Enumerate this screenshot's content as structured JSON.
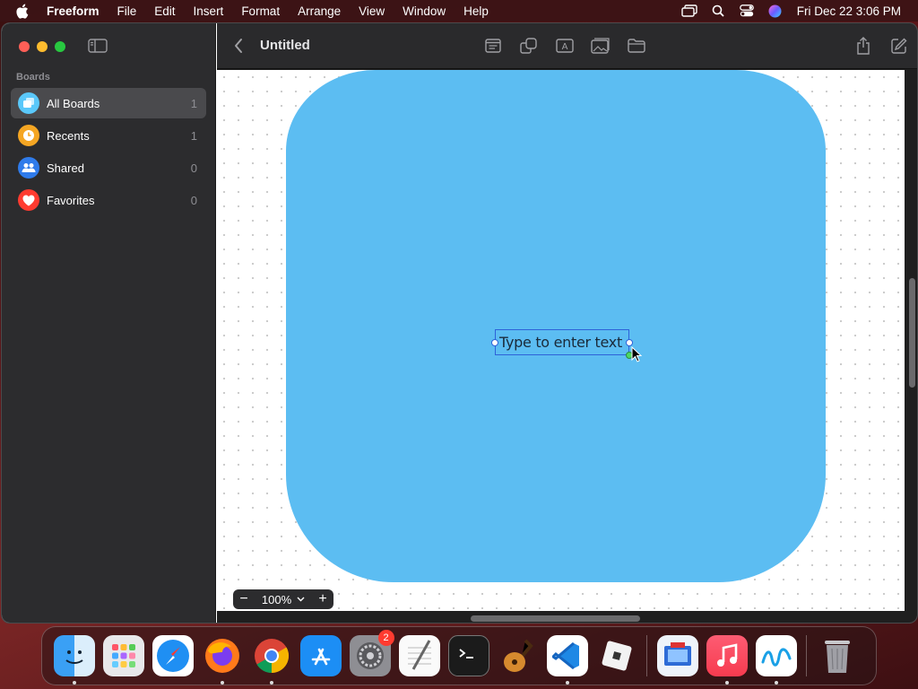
{
  "menubar": {
    "app_name": "Freeform",
    "items": [
      "File",
      "Edit",
      "Insert",
      "Format",
      "Arrange",
      "View",
      "Window",
      "Help"
    ],
    "clock": "Fri Dec 22  3:06 PM",
    "status_icons": [
      "screen-mirroring-icon",
      "search-icon",
      "control-center-icon",
      "siri-icon"
    ]
  },
  "sidebar": {
    "heading": "Boards",
    "items": [
      {
        "label": "All Boards",
        "count": "1",
        "icon": "all-boards-icon",
        "color": "#5ac8fa"
      },
      {
        "label": "Recents",
        "count": "1",
        "icon": "clock-icon",
        "color": "#f5a623"
      },
      {
        "label": "Shared",
        "count": "0",
        "icon": "people-icon",
        "color": "#2f7bea"
      },
      {
        "label": "Favorites",
        "count": "0",
        "icon": "heart-icon",
        "color": "#ff3b30"
      }
    ]
  },
  "toolbar": {
    "title": "Untitled",
    "tools": [
      "sticky-note-icon",
      "shapes-icon",
      "text-box-icon",
      "media-icon",
      "file-icon"
    ],
    "right": [
      "share-icon",
      "new-board-icon"
    ]
  },
  "canvas": {
    "shape_color": "#5cbdf2",
    "textbox_text": "Type to enter text"
  },
  "zoom": {
    "value": "100%"
  },
  "dock": {
    "apps": [
      "Finder",
      "Launchpad",
      "Safari",
      "Firefox",
      "Chrome",
      "App Store",
      "System Settings",
      "TextEdit",
      "Terminal",
      "GarageBand",
      "Visual Studio Code",
      "Roblox",
      "Remote Desktop",
      "Music",
      "Freeform",
      "Trash"
    ],
    "settings_badge": "2"
  }
}
